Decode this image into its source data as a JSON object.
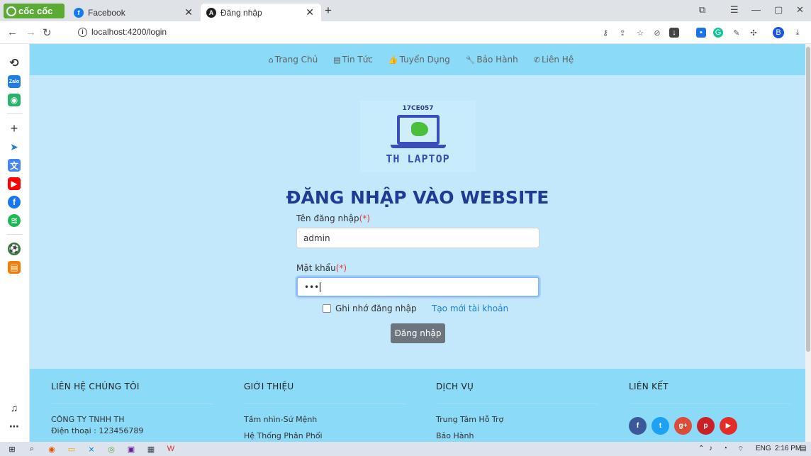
{
  "browser": {
    "brand": "cốc cốc",
    "tabs": [
      {
        "title": "Facebook",
        "favicon_color": "#1877f2"
      },
      {
        "title": "Đăng nhập",
        "favicon_color": "#dd0031"
      }
    ],
    "url": "localhost:4200/login"
  },
  "nav": {
    "items": [
      {
        "label": "Trang Chủ",
        "icon": "home-icon"
      },
      {
        "label": "Tin Tức",
        "icon": "newspaper-icon"
      },
      {
        "label": "Tuyển Dụng",
        "icon": "thumbs-up-icon"
      },
      {
        "label": "Bảo Hành",
        "icon": "wrench-icon"
      },
      {
        "label": "Liên Hệ",
        "icon": "phone-icon"
      }
    ]
  },
  "logo": {
    "code": "17CE057",
    "brand": "TH LAPTOP"
  },
  "login": {
    "title": "ĐĂNG NHẬP VÀO WEBSITE",
    "username_label": "Tên đăng nhập",
    "password_label": "Mật khẩu",
    "required_mark": "(*)",
    "username_value": "admin",
    "password_value": "•••",
    "remember_label": "Ghi nhớ đăng nhập",
    "create_account": "Tạo mới tài khoản",
    "submit": "Đăng nhập"
  },
  "footer": {
    "contact": {
      "heading": "LIÊN HỆ CHÚNG TÔI",
      "lines": [
        "CÔNG TY TNHH TH",
        "Điện thoại : 123456789"
      ]
    },
    "about": {
      "heading": "GIỚI THIỆU",
      "lines": [
        "Tầm nhìn-Sứ Mệnh",
        "Hệ Thống Phân Phối"
      ]
    },
    "services": {
      "heading": "DỊCH VỤ",
      "lines": [
        "Trung Tâm Hỗ Trợ",
        "Bảo Hành"
      ]
    },
    "links": {
      "heading": "LIÊN KẾT"
    }
  },
  "taskbar": {
    "lang": "ENG",
    "time": "2:16 PM"
  },
  "colors": {
    "page_bg": "#c3e7fb",
    "nav_bg": "#8adaf8",
    "title": "#1e3c96",
    "button": "#6c757d",
    "link": "#1a7fd0"
  }
}
